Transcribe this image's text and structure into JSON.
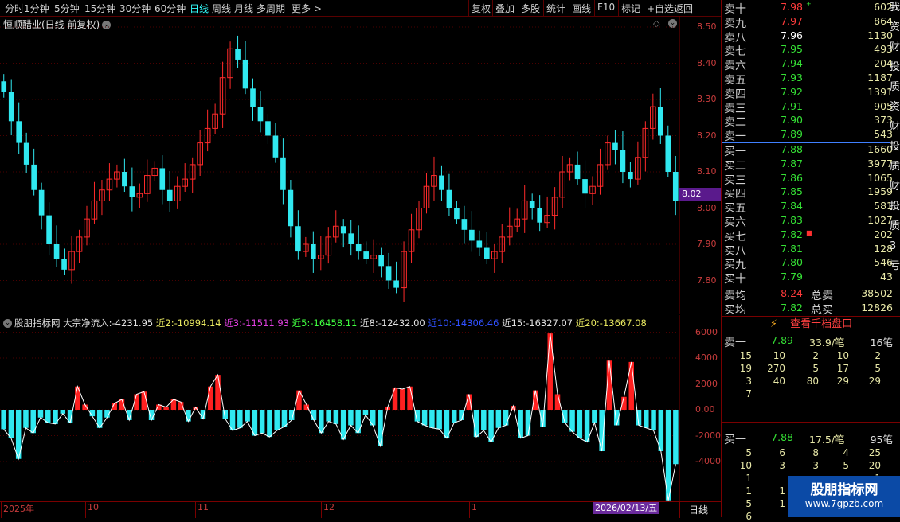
{
  "toolbar": {
    "left_items": [
      "分时",
      "1分钟",
      "5分钟",
      "15分钟",
      "30分钟",
      "60分钟",
      "日线",
      "周线",
      "月线",
      "多周期",
      "更多 >"
    ],
    "right_items": [
      "复权",
      "叠加",
      "多股",
      "统计",
      "画线",
      "F10",
      "标记",
      "+自选",
      "返回"
    ],
    "active": "日线"
  },
  "main_chart": {
    "title": "恒顺醋业(日线 前复权)",
    "price_axis": [
      "8.50",
      "8.40",
      "8.30",
      "8.20",
      "8.10",
      "8.00",
      "7.90",
      "7.80"
    ],
    "current_price": "8.02",
    "colors": {
      "up": "#ff2020",
      "down": "#30e8f0",
      "grid": "#5a0000",
      "axis": "#c83c3c"
    }
  },
  "indicator": {
    "name": "股朋指标网",
    "fields": [
      {
        "label": "大宗净流入:",
        "value": "-4231.95",
        "color": "#e0e0e0"
      },
      {
        "label": "近2:",
        "value": "-10994.14",
        "color": "#e8e860"
      },
      {
        "label": "近3:",
        "value": "-11511.93",
        "color": "#e040e0"
      },
      {
        "label": "近5:",
        "value": "-16458.11",
        "color": "#40ff40"
      },
      {
        "label": "近8:",
        "value": "-12432.00",
        "color": "#e0e0e0"
      },
      {
        "label": "近10:",
        "value": "-14306.46",
        "color": "#3050ff"
      },
      {
        "label": "近15:",
        "value": "-16327.07",
        "color": "#e0e0e0"
      },
      {
        "label": "近20:",
        "value": "-13667.08",
        "color": "#e8e860"
      }
    ],
    "axis": [
      "6000",
      "4000",
      "2000",
      "0.00",
      "-2000",
      "-4000"
    ]
  },
  "date_axis": {
    "labels": [
      "2025年",
      "10",
      "11",
      "12",
      "1"
    ],
    "cursor_date": "2026/02/13/五",
    "period": "日线"
  },
  "order_book": {
    "sell": [
      {
        "label": "卖十",
        "price": "7.98",
        "vol": "602",
        "pc": "red",
        "mark": "±"
      },
      {
        "label": "卖九",
        "price": "7.97",
        "vol": "864",
        "pc": "red"
      },
      {
        "label": "卖八",
        "price": "7.96",
        "vol": "1130",
        "pc": "wht"
      },
      {
        "label": "卖七",
        "price": "7.95",
        "vol": "493",
        "pc": "grn"
      },
      {
        "label": "卖六",
        "price": "7.94",
        "vol": "204",
        "pc": "grn"
      },
      {
        "label": "卖五",
        "price": "7.93",
        "vol": "1187",
        "pc": "grn"
      },
      {
        "label": "卖四",
        "price": "7.92",
        "vol": "1391",
        "pc": "grn"
      },
      {
        "label": "卖三",
        "price": "7.91",
        "vol": "905",
        "pc": "grn"
      },
      {
        "label": "卖二",
        "price": "7.90",
        "vol": "373",
        "pc": "grn"
      },
      {
        "label": "卖一",
        "price": "7.89",
        "vol": "543",
        "pc": "grn"
      }
    ],
    "buy": [
      {
        "label": "买一",
        "price": "7.88",
        "vol": "1660",
        "pc": "grn"
      },
      {
        "label": "买二",
        "price": "7.87",
        "vol": "3977",
        "pc": "grn"
      },
      {
        "label": "买三",
        "price": "7.86",
        "vol": "1065",
        "pc": "grn"
      },
      {
        "label": "买四",
        "price": "7.85",
        "vol": "1959",
        "pc": "grn"
      },
      {
        "label": "买五",
        "price": "7.84",
        "vol": "581",
        "pc": "grn"
      },
      {
        "label": "买六",
        "price": "7.83",
        "vol": "1027",
        "pc": "grn"
      },
      {
        "label": "买七",
        "price": "7.82",
        "vol": "202",
        "pc": "grn",
        "mark": "■"
      },
      {
        "label": "买八",
        "price": "7.81",
        "vol": "128",
        "pc": "grn"
      },
      {
        "label": "买九",
        "price": "7.80",
        "vol": "546",
        "pc": "grn"
      },
      {
        "label": "买十",
        "price": "7.79",
        "vol": "43",
        "pc": "grn"
      }
    ],
    "avg_sell": {
      "label": "卖均",
      "price": "8.24",
      "total_label": "总卖",
      "total": "38502"
    },
    "avg_buy": {
      "label": "买均",
      "price": "7.82",
      "total_label": "总买",
      "total": "12826"
    },
    "qiandang": "查看千档盘口",
    "sell1_summary": {
      "label": "卖一",
      "price": "7.89",
      "avg": "33.9/笔",
      "count": "16笔"
    },
    "sell1_ticks": [
      [
        "15",
        "10",
        "2",
        "10",
        "2"
      ],
      [
        "19",
        "270",
        "5",
        "17",
        "5"
      ],
      [
        "3",
        "40",
        "80",
        "29",
        "29"
      ],
      [
        "7",
        "",
        "",
        "",
        ""
      ]
    ],
    "buy1_summary": {
      "label": "买一",
      "price": "7.88",
      "avg": "17.5/笔",
      "count": "95笔"
    },
    "buy1_ticks": [
      [
        "5",
        "6",
        "8",
        "4",
        "25"
      ],
      [
        "10",
        "3",
        "3",
        "5",
        "20"
      ],
      [
        "1",
        "",
        "",
        "",
        "1"
      ],
      [
        "1",
        "1",
        "",
        "",
        ""
      ],
      [
        "5",
        "1",
        "",
        "",
        ""
      ],
      [
        "6",
        "",
        "",
        "",
        ""
      ]
    ],
    "side_chars": [
      "我",
      "资",
      "财",
      "投",
      "质",
      "资",
      "财",
      "投",
      "质",
      "财",
      "投",
      "质",
      "3",
      "亏"
    ]
  },
  "watermark": {
    "title": "股朋指标网",
    "url": "www.7gpzb.com"
  }
}
